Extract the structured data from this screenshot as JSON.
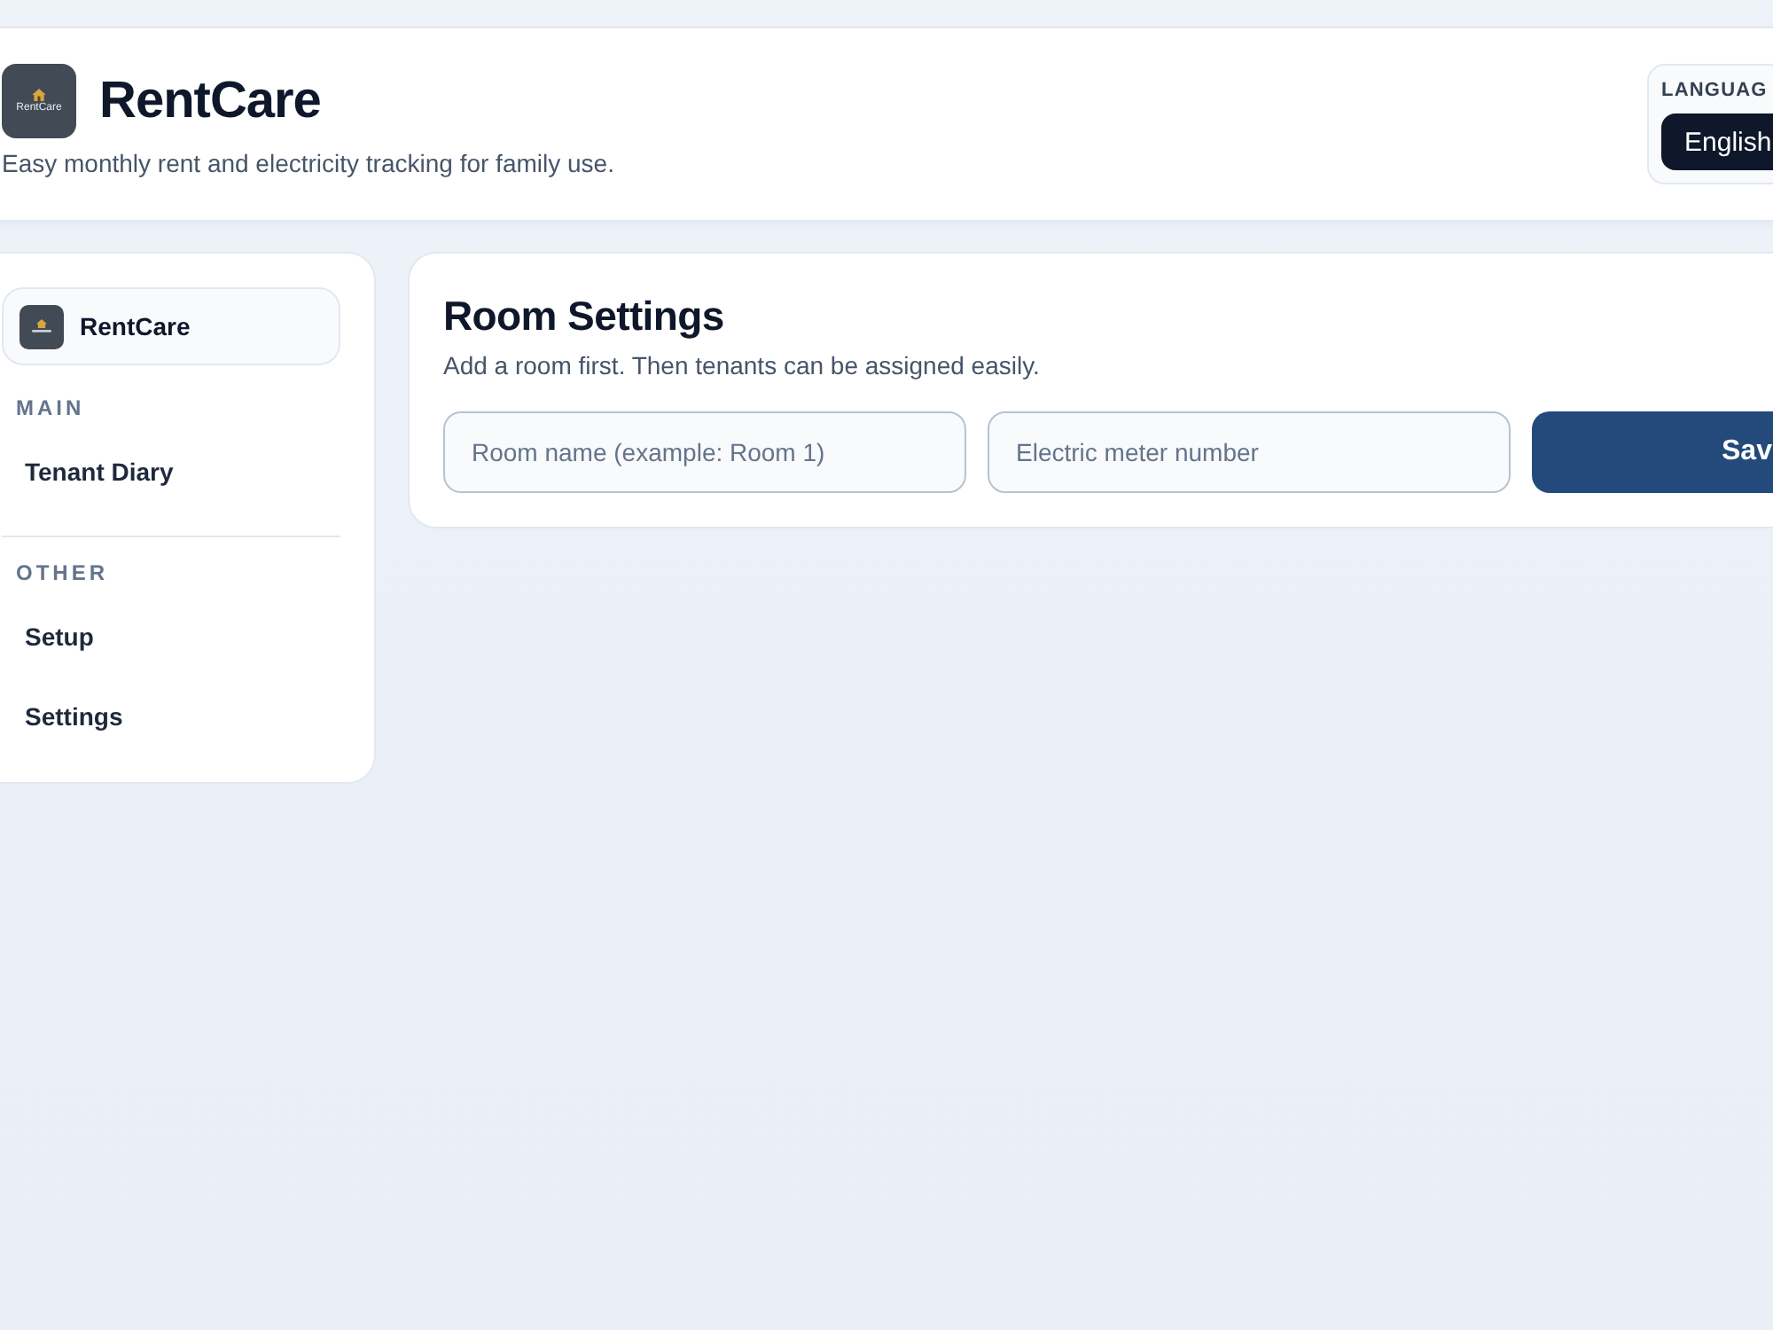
{
  "header": {
    "logo_text": "RentCare",
    "title": "RentCare",
    "subtitle": "Easy monthly rent and electricity tracking for family use.",
    "language": {
      "label": "LANGUAG",
      "options": [
        {
          "label": "English",
          "selected": true
        }
      ]
    }
  },
  "sidebar": {
    "brand": "RentCare",
    "sections": [
      {
        "heading": "MAIN",
        "items": [
          {
            "label": "Tenant Diary"
          }
        ]
      },
      {
        "heading": "OTHER",
        "items": [
          {
            "label": "Setup"
          },
          {
            "label": "Settings"
          }
        ]
      }
    ]
  },
  "main": {
    "title": "Room Settings",
    "description": "Add a room first. Then tenants can be assigned easily.",
    "fields": [
      {
        "placeholder": "Room name (example: Room 1)"
      },
      {
        "placeholder": "Electric meter number"
      }
    ],
    "button": "Sav"
  }
}
